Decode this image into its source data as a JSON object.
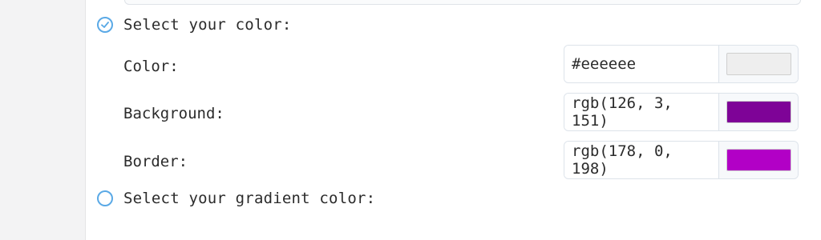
{
  "options": {
    "solid_label": "Select your color:",
    "gradient_label": "Select your gradient color:",
    "solid_selected": true,
    "gradient_selected": false
  },
  "fields": [
    {
      "label": "Color:",
      "value": "#eeeeee",
      "swatch": "#eeeeee"
    },
    {
      "label": "Background:",
      "value": "rgb(126, 3, 151)",
      "swatch": "#7e0397"
    },
    {
      "label": "Border:",
      "value": "rgb(178, 0, 198)",
      "swatch": "#b200c6"
    }
  ],
  "colors": {
    "accent": "#5aa9e6"
  }
}
